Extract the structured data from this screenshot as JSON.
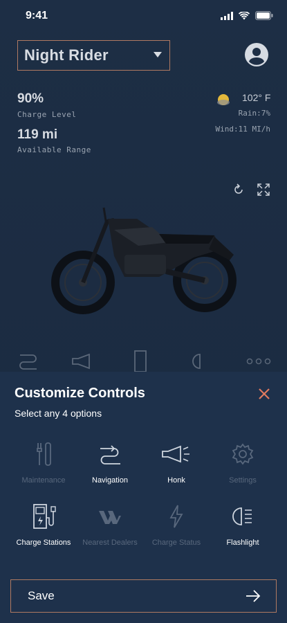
{
  "status": {
    "time": "9:41"
  },
  "header": {
    "vehicle_name": "Night Rider"
  },
  "stats": {
    "charge_value": "90%",
    "charge_label": "Charge Level",
    "range_value": "119 mi",
    "range_label": "Available Range"
  },
  "weather": {
    "temp": "102° F",
    "rain": "Rain:7%",
    "wind": "Wind:11 MI/h"
  },
  "sheet": {
    "title": "Customize Controls",
    "subtitle": "Select any 4 options",
    "options": [
      {
        "label": "Maintenance",
        "icon": "wrench-icon",
        "selected": false
      },
      {
        "label": "Navigation",
        "icon": "route-icon",
        "selected": true
      },
      {
        "label": "Honk",
        "icon": "horn-icon",
        "selected": true
      },
      {
        "label": "Settings",
        "icon": "gear-icon",
        "selected": false
      },
      {
        "label": "Charge Stations",
        "icon": "charge-station-icon",
        "selected": true
      },
      {
        "label": "Nearest Dealers",
        "icon": "dealer-logo-icon",
        "selected": false
      },
      {
        "label": "Charge Status",
        "icon": "bolt-icon",
        "selected": false
      },
      {
        "label": "Flashlight",
        "icon": "headlight-icon",
        "selected": true
      }
    ],
    "save_label": "Save"
  },
  "colors": {
    "background": "#1c2c42",
    "sheet": "#1e314b",
    "accent_border": "#b07a62",
    "close_icon": "#e07a5f",
    "disabled_text": "#59687d"
  }
}
